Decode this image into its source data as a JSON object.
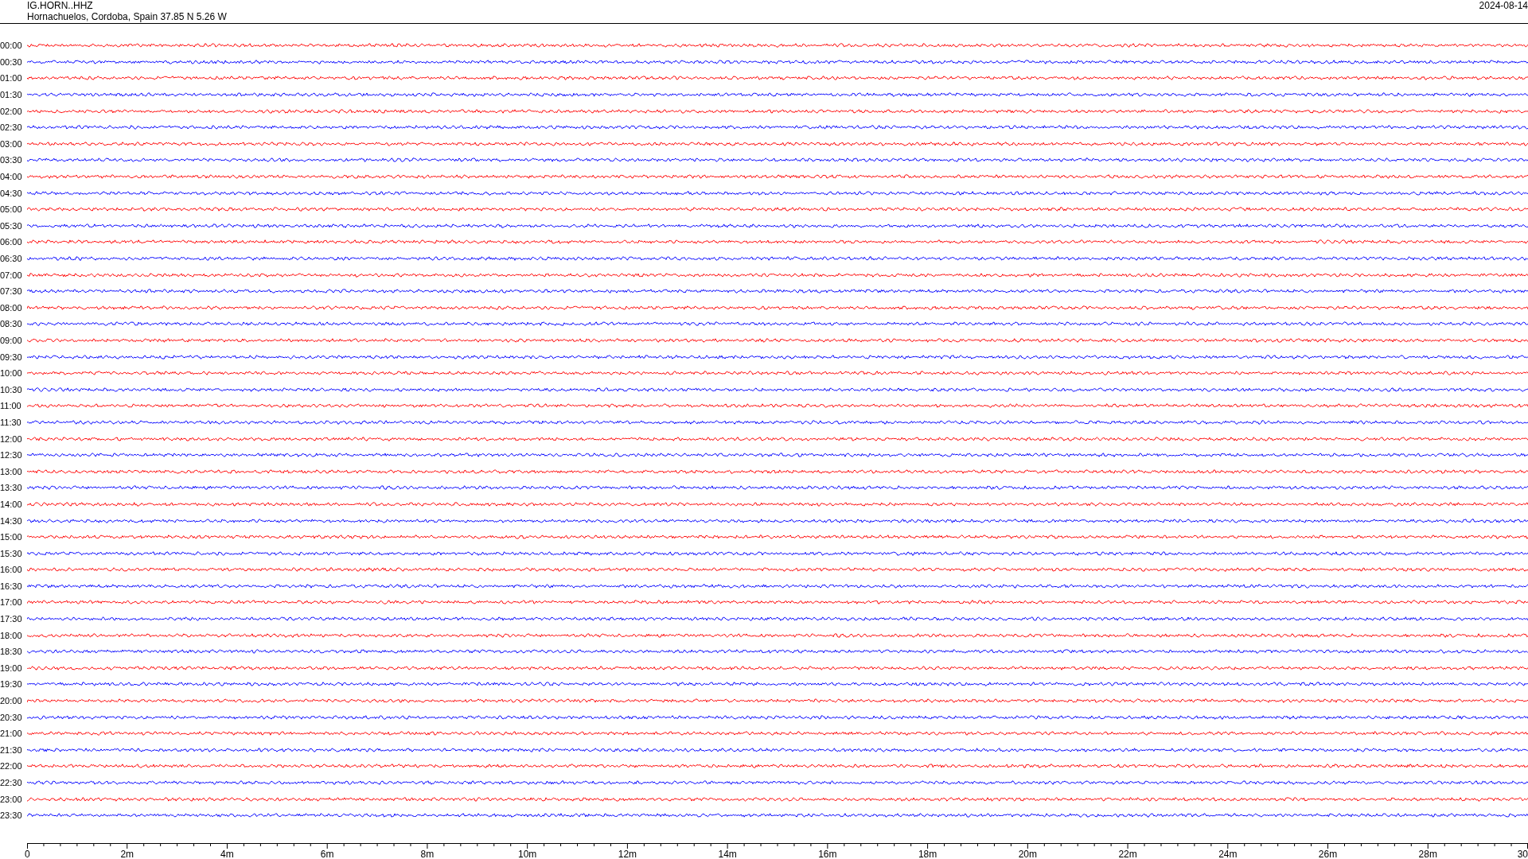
{
  "header": {
    "station": "IG.HORN..HHZ",
    "location": "Hornachuelos, Cordoba, Spain  37.85 N 5.26 W",
    "date": "2024-08-14"
  },
  "rows": [
    {
      "label": "00:00",
      "color": "#ff0000"
    },
    {
      "label": "00:30",
      "color": "#0000ff"
    },
    {
      "label": "01:00",
      "color": "#ff0000"
    },
    {
      "label": "01:30",
      "color": "#0000ff"
    },
    {
      "label": "02:00",
      "color": "#ff0000"
    },
    {
      "label": "02:30",
      "color": "#0000ff"
    },
    {
      "label": "03:00",
      "color": "#ff0000"
    },
    {
      "label": "03:30",
      "color": "#0000ff"
    },
    {
      "label": "04:00",
      "color": "#ff0000"
    },
    {
      "label": "04:30",
      "color": "#0000ff"
    },
    {
      "label": "05:00",
      "color": "#ff0000"
    },
    {
      "label": "05:30",
      "color": "#0000ff"
    },
    {
      "label": "06:00",
      "color": "#ff0000"
    },
    {
      "label": "06:30",
      "color": "#0000ff"
    },
    {
      "label": "07:00",
      "color": "#ff0000"
    },
    {
      "label": "07:30",
      "color": "#0000ff"
    },
    {
      "label": "08:00",
      "color": "#ff0000"
    },
    {
      "label": "08:30",
      "color": "#0000ff"
    },
    {
      "label": "09:00",
      "color": "#ff0000"
    },
    {
      "label": "09:30",
      "color": "#0000ff"
    },
    {
      "label": "10:00",
      "color": "#ff0000"
    },
    {
      "label": "10:30",
      "color": "#0000ff"
    },
    {
      "label": "11:00",
      "color": "#ff0000"
    },
    {
      "label": "11:30",
      "color": "#0000ff"
    },
    {
      "label": "12:00",
      "color": "#ff0000"
    },
    {
      "label": "12:30",
      "color": "#0000ff"
    },
    {
      "label": "13:00",
      "color": "#ff0000"
    },
    {
      "label": "13:30",
      "color": "#0000ff"
    },
    {
      "label": "14:00",
      "color": "#ff0000"
    },
    {
      "label": "14:30",
      "color": "#0000ff"
    },
    {
      "label": "15:00",
      "color": "#ff0000"
    },
    {
      "label": "15:30",
      "color": "#0000ff"
    },
    {
      "label": "16:00",
      "color": "#ff0000"
    },
    {
      "label": "16:30",
      "color": "#0000ff"
    },
    {
      "label": "17:00",
      "color": "#ff0000"
    },
    {
      "label": "17:30",
      "color": "#0000ff"
    },
    {
      "label": "18:00",
      "color": "#ff0000"
    },
    {
      "label": "18:30",
      "color": "#0000ff"
    },
    {
      "label": "19:00",
      "color": "#ff0000"
    },
    {
      "label": "19:30",
      "color": "#0000ff"
    },
    {
      "label": "20:00",
      "color": "#ff0000"
    },
    {
      "label": "20:30",
      "color": "#0000ff"
    },
    {
      "label": "21:00",
      "color": "#ff0000"
    },
    {
      "label": "21:30",
      "color": "#0000ff"
    },
    {
      "label": "22:00",
      "color": "#ff0000"
    },
    {
      "label": "22:30",
      "color": "#0000ff"
    },
    {
      "label": "23:00",
      "color": "#ff0000"
    },
    {
      "label": "23:30",
      "color": "#0000ff"
    }
  ],
  "axis_labels": [
    "0",
    "2m",
    "4m",
    "6m",
    "8m",
    "10m",
    "12m",
    "14m",
    "16m",
    "18m",
    "20m",
    "22m",
    "24m",
    "26m",
    "28m",
    "30"
  ]
}
